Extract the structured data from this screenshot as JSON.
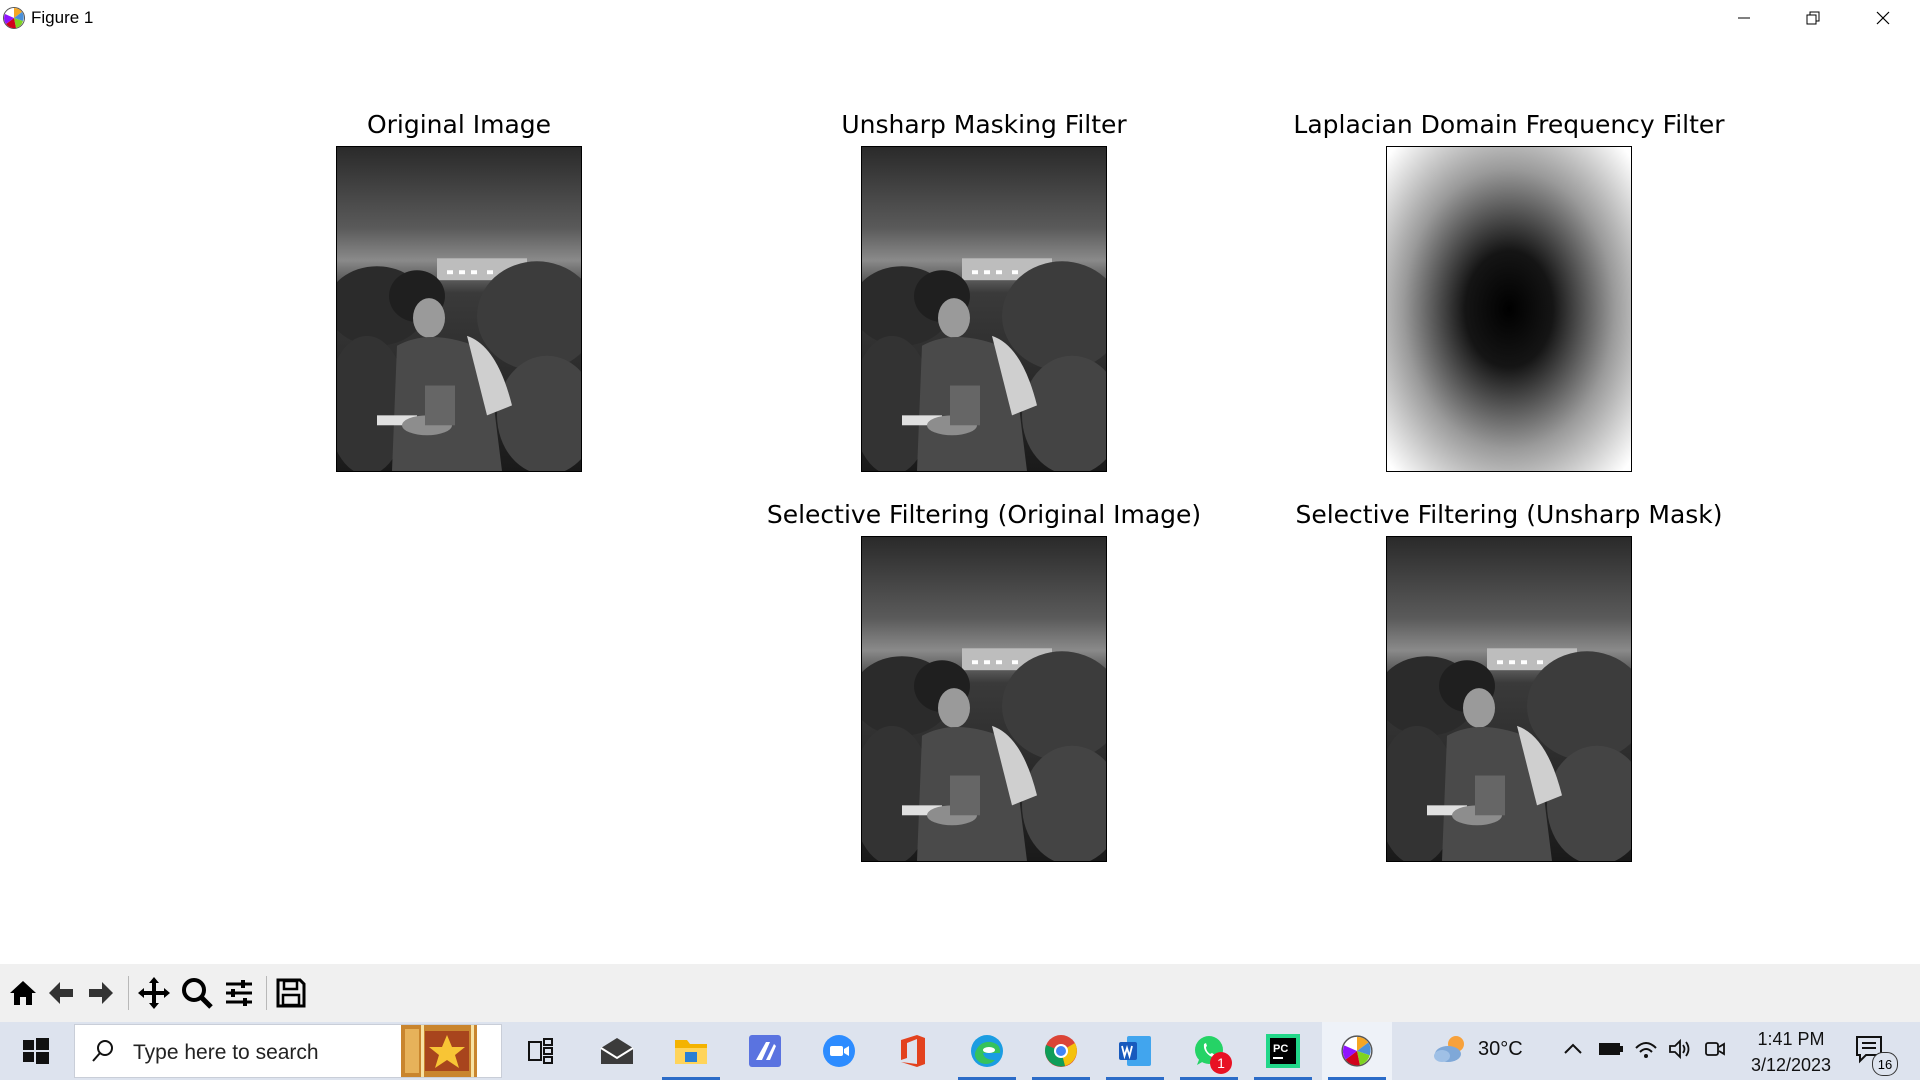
{
  "window": {
    "title": "Figure 1",
    "controls": [
      "minimize",
      "restore",
      "close"
    ]
  },
  "figure": {
    "subplots": [
      {
        "title": "Original Image",
        "content": "grayscale-photo"
      },
      {
        "title": "Unsharp Masking Filter",
        "content": "grayscale-photo"
      },
      {
        "title": "Laplacian Domain Frequency Filter",
        "content": "frequency-filter-gradient"
      },
      {
        "title": "Selective Filtering (Original Image)",
        "content": "grayscale-photo"
      },
      {
        "title": "Selective Filtering (Unsharp Mask)",
        "content": "grayscale-photo"
      }
    ]
  },
  "toolbar": {
    "buttons": [
      "home-icon",
      "back-icon",
      "forward-icon",
      "pan-icon",
      "zoom-icon",
      "configure-subplots-icon",
      "save-icon"
    ]
  },
  "taskbar": {
    "search_placeholder": "Type here to search",
    "apps": [
      "task-view",
      "mail",
      "file-explorer",
      "app-a",
      "zoom",
      "office",
      "edge",
      "chrome",
      "word",
      "whatsapp",
      "pycharm",
      "matplotlib"
    ],
    "whatsapp_badge": "1",
    "weather": "30°C",
    "time": "1:41 PM",
    "date": "3/12/2023",
    "notification_count": "16"
  }
}
